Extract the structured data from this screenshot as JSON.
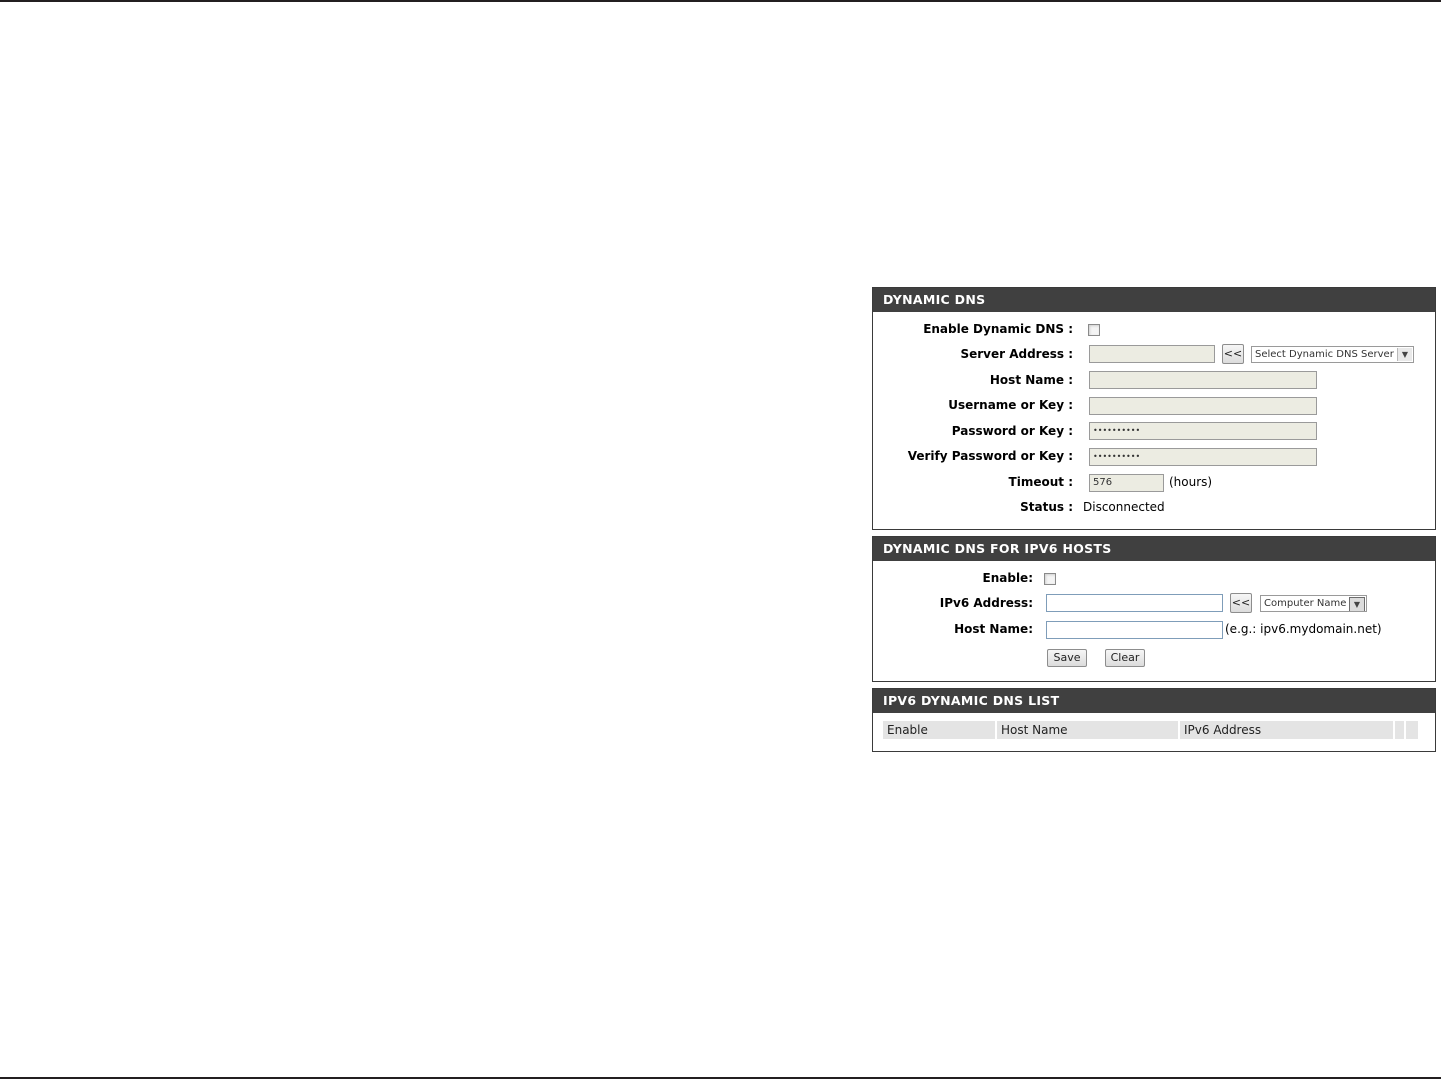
{
  "dynamic_dns": {
    "title": "DYNAMIC DNS",
    "enable_label": "Enable Dynamic DNS :",
    "server_address_label": "Server Address :",
    "server_address_value": "",
    "server_select_button": "<<",
    "server_select_value": "Select Dynamic DNS Server",
    "host_name_label": "Host Name :",
    "host_name_value": "",
    "username_label": "Username or Key :",
    "username_value": "",
    "password_label": "Password or Key :",
    "password_value": "••••••••••",
    "verify_password_label": "Verify Password or Key  :",
    "verify_password_value": "••••••••••",
    "timeout_label": "Timeout  :",
    "timeout_value": "576",
    "timeout_unit": "(hours)",
    "status_label": "Status  :",
    "status_value": "Disconnected",
    "enabled": false
  },
  "ipv6_hosts": {
    "title": "DYNAMIC DNS FOR IPV6 HOSTS",
    "enable_label": "Enable:",
    "ipv6_address_label": "IPv6 Address:",
    "ipv6_address_value": "",
    "computer_select_button": "<<",
    "computer_select_value": "Computer Name",
    "host_name_label": "Host Name:",
    "host_name_value": "",
    "host_name_hint": "(e.g.: ipv6.mydomain.net)",
    "save_label": "Save",
    "clear_label": "Clear",
    "enabled": false
  },
  "ipv6_list": {
    "title": "IPV6 DYNAMIC DNS LIST",
    "columns": [
      "Enable",
      "Host Name",
      "IPv6 Address"
    ]
  }
}
